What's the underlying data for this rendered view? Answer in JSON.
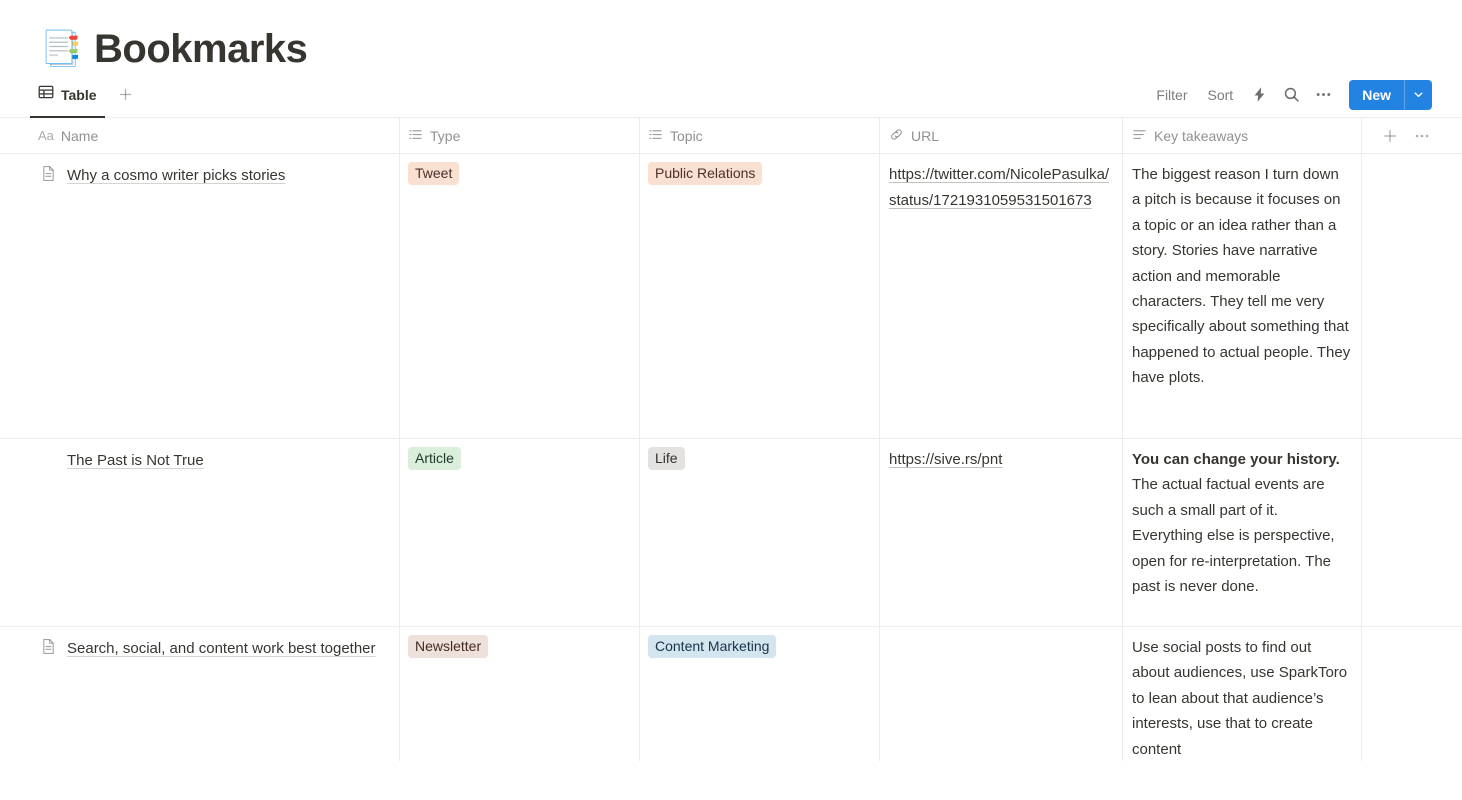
{
  "page": {
    "emoji": "📑",
    "emoji_name": "bookmark-tabs",
    "title": "Bookmarks"
  },
  "view_bar": {
    "tab": {
      "label": "Table",
      "icon": "table-icon"
    },
    "add_view_label": "+",
    "filter_label": "Filter",
    "sort_label": "Sort",
    "automation_icon": "lightning-icon",
    "search_icon": "search-icon",
    "more_icon": "ellipsis-icon",
    "new_label": "New",
    "new_caret_icon": "chevron-down-icon",
    "accent_color": "#2383E2"
  },
  "table": {
    "columns": [
      {
        "key": "name",
        "label": "Name",
        "icon": "title-text-icon"
      },
      {
        "key": "type",
        "label": "Type",
        "icon": "select-list-icon"
      },
      {
        "key": "topic",
        "label": "Topic",
        "icon": "select-list-icon"
      },
      {
        "key": "url",
        "label": "URL",
        "icon": "link-icon"
      },
      {
        "key": "key_takeaways",
        "label": "Key takeaways",
        "icon": "text-lines-icon"
      }
    ],
    "add_column_icon": "plus-icon",
    "column_menu_icon": "ellipsis-icon",
    "rows": [
      {
        "name": "Why a cosmo writer picks stories",
        "has_page_icon": true,
        "type": {
          "label": "Tweet",
          "bg": "#FAE0D0",
          "fg": "#49312B"
        },
        "topic": {
          "label": "Public Relations",
          "bg": "#FAE0D0",
          "fg": "#49312B"
        },
        "url": "https://twitter.com/NicolePasulka/status/1721931059531501673",
        "key_takeaways_bold": "",
        "key_takeaways": "The biggest reason I turn down a pitch is because it focuses on a topic or an idea rather than a story. Stories have narrative action and memorable characters. They tell me very specifically about something that happened to actual people. They have plots."
      },
      {
        "name": "The Past is Not True",
        "has_page_icon": false,
        "type": {
          "label": "Article",
          "bg": "#DBEDDB",
          "fg": "#1C3829"
        },
        "topic": {
          "label": "Life",
          "bg": "#E3E2E0",
          "fg": "#32302C"
        },
        "url": "https://sive.rs/pnt",
        "key_takeaways_bold": "You can change your history.",
        "key_takeaways": " The actual factual events are such a small part of it. Everything else is perspective, open for re-interpretation. The past is never done."
      },
      {
        "name": "Search, social, and content work best together",
        "has_page_icon": true,
        "type": {
          "label": "Newsletter",
          "bg": "#EEE0DA",
          "fg": "#442A1E"
        },
        "topic": {
          "label": "Content Marketing",
          "bg": "#D3E5EF",
          "fg": "#183347"
        },
        "url": "",
        "key_takeaways_bold": "",
        "key_takeaways": "Use social posts to find out about audiences, use SparkToro to lean about that audience’s interests, use that to create content"
      }
    ]
  }
}
